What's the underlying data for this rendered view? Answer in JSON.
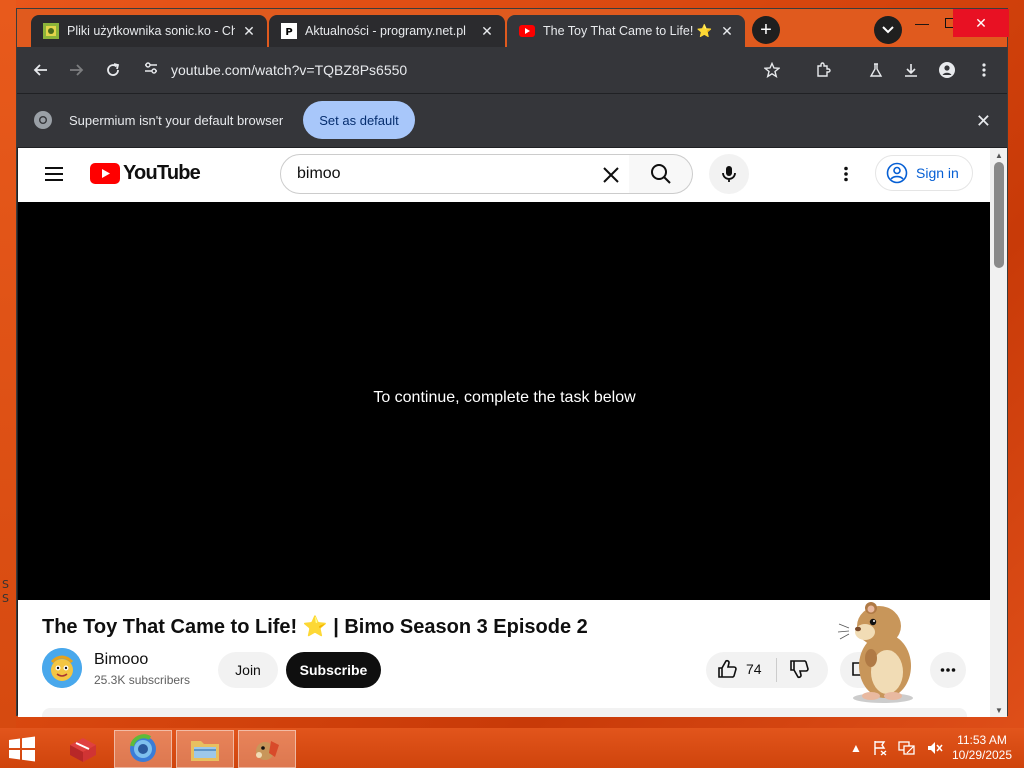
{
  "browser": {
    "tabs": [
      {
        "label": "Pliki użytkownika sonic.ko - Cho",
        "favicon": "site-favicon"
      },
      {
        "label": "Aktualności - programy.net.pl",
        "favicon": "programy-favicon"
      },
      {
        "label": "The Toy That Came to Life! ⭐ | ",
        "favicon": "youtube-favicon"
      }
    ],
    "url": "youtube.com/watch?v=TQBZ8Ps6550"
  },
  "infobar": {
    "message": "Supermium isn't your default browser",
    "button_label": "Set as default"
  },
  "youtube": {
    "logo_text": "YouTube",
    "search_value": "bimoo",
    "signin_label": "Sign in",
    "player_message": "To continue, complete the task below",
    "video_title": "The Toy That Came to Life! ⭐ | Bimo Season 3 Episode 2",
    "channel_name": "Bimooo",
    "channel_subs": "25.3K subscribers",
    "join_label": "Join",
    "subscribe_label": "Subscribe",
    "like_count": "74"
  },
  "taskbar": {
    "time": "11:53 AM",
    "date": "10/29/2025"
  },
  "colors": {
    "accent_desktop": "#d9480f",
    "youtube_red": "#ff0000",
    "button_blue": "#a8c7fa",
    "signin_blue": "#065fd4"
  }
}
